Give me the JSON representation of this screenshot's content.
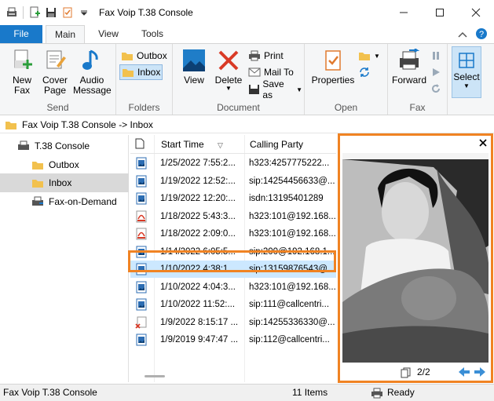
{
  "window": {
    "title": "Fax Voip T.38 Console"
  },
  "tabs": {
    "file": "File",
    "main": "Main",
    "view": "View",
    "tools": "Tools"
  },
  "ribbon": {
    "send": {
      "label": "Send",
      "new_fax": "New Fax",
      "cover_page": "Cover Page",
      "audio_message": "Audio Message"
    },
    "folders": {
      "label": "Folders",
      "outbox": "Outbox",
      "inbox": "Inbox"
    },
    "document": {
      "label": "Document",
      "view": "View",
      "delete": "Delete",
      "print": "Print",
      "mail_to": "Mail To",
      "save_as": "Save as"
    },
    "open": {
      "label": "Open",
      "properties": "Properties"
    },
    "fax": {
      "label": "Fax",
      "forward": "Forward"
    },
    "select": {
      "label": "Select"
    }
  },
  "path": "Fax Voip T.38 Console -> Inbox",
  "tree": [
    {
      "label": "T.38 Console"
    },
    {
      "label": "Outbox"
    },
    {
      "label": "Inbox"
    },
    {
      "label": "Fax-on-Demand"
    }
  ],
  "list": {
    "columns": {
      "start": "Start Time",
      "calling": "Calling Party"
    },
    "rows": [
      {
        "icon": "fax-image",
        "start": "1/25/2022 7:55:2...",
        "calling": "h323:4257775222..."
      },
      {
        "icon": "fax-image",
        "start": "1/19/2022 12:52:...",
        "calling": "sip:14254456633@..."
      },
      {
        "icon": "fax-image",
        "start": "1/19/2022 12:20:...",
        "calling": "isdn:13195401289"
      },
      {
        "icon": "pdf",
        "start": "1/18/2022 5:43:3...",
        "calling": "h323:101@192.168...."
      },
      {
        "icon": "pdf",
        "start": "1/18/2022 2:09:0...",
        "calling": "h323:101@192.168...."
      },
      {
        "icon": "fax-image",
        "start": "1/14/2022 6:05:5...",
        "calling": "sip:200@192.168.1...."
      },
      {
        "icon": "fax-image",
        "start": "1/10/2022 4:38:1...",
        "calling": "sip:13159876543@..."
      },
      {
        "icon": "fax-image",
        "start": "1/10/2022 4:04:3...",
        "calling": "h323:101@192.168...."
      },
      {
        "icon": "fax-image",
        "start": "1/10/2022 11:52:...",
        "calling": "sip:111@callcentri..."
      },
      {
        "icon": "fax-failed",
        "start": "1/9/2022 8:15:17 ...",
        "calling": "sip:14255336330@..."
      },
      {
        "icon": "fax-image",
        "start": "1/9/2019 9:47:47 ...",
        "calling": "sip:112@callcentri..."
      }
    ]
  },
  "preview": {
    "page": "2/2"
  },
  "status": {
    "app": "Fax Voip T.38 Console",
    "items": "11 Items",
    "state": "Ready"
  },
  "colors": {
    "accent": "#1979ca",
    "highlight": "#f08323",
    "selection": "#cce8ff"
  }
}
